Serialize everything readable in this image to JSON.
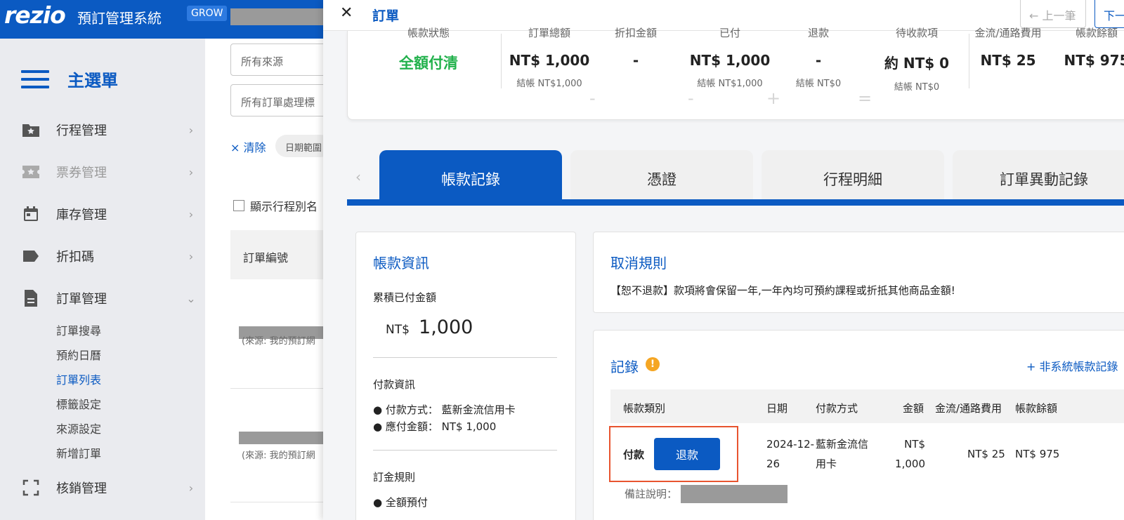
{
  "topbar": {
    "logo": "rezio",
    "system_title": "預訂管理系統",
    "plan_badge": "GROW"
  },
  "sidebar": {
    "title": "主選單",
    "items": [
      {
        "label": "行程管理",
        "icon": "folder-star-icon"
      },
      {
        "label": "票券管理",
        "icon": "ticket-star-icon"
      },
      {
        "label": "庫存管理",
        "icon": "calendar-icon"
      },
      {
        "label": "折扣碼",
        "icon": "tag-icon"
      },
      {
        "label": "訂單管理",
        "icon": "document-icon"
      },
      {
        "label": "核銷管理",
        "icon": "scan-icon"
      }
    ],
    "sub_items": [
      "訂單搜尋",
      "預約日曆",
      "訂單列表",
      "標籤設定",
      "來源設定",
      "新增訂單"
    ],
    "active_sub_item": "訂單列表"
  },
  "background_list": {
    "source_filter_placeholder": "所有來源",
    "tag_filter_placeholder": "所有訂單處理標",
    "clear_label": "× 清除",
    "date_chip": "日期範圍",
    "show_tour_name_label": "顯示行程別名",
    "column_header": "訂單編號",
    "rows": [
      {
        "source_text": "(來源: 我的預訂網"
      },
      {
        "source_text": "(來源: 我的預訂網"
      }
    ]
  },
  "panel": {
    "title": "訂單",
    "prev_label": "← 上一筆",
    "next_label": "下一"
  },
  "summary": {
    "status_label": "帳款狀態",
    "status_value": "全額付清",
    "total_label": "訂單總額",
    "total_value": "NT$ 1,000",
    "total_sub": "結帳 NT$1,000",
    "discount_label": "折扣金額",
    "discount_value": "-",
    "paid_label": "已付",
    "paid_value": "NT$ 1,000",
    "paid_sub": "結帳 NT$1,000",
    "refund_label": "退款",
    "refund_value": "-",
    "refund_sub": "結帳 NT$0",
    "receivable_label": "待收款項",
    "receivable_value": "約 NT$ 0",
    "receivable_sub": "結帳 NT$0",
    "fee_label": "金流/通路費用",
    "fee_value": "NT$ 25",
    "balance_label": "帳款餘額",
    "balance_value": "NT$ 975",
    "op_minus": "-",
    "op_plus": "+",
    "op_equal": "="
  },
  "tabs": [
    {
      "label": "帳款記錄",
      "active": true
    },
    {
      "label": "憑證",
      "active": false
    },
    {
      "label": "行程明細",
      "active": false
    },
    {
      "label": "訂單異動記錄",
      "active": false
    }
  ],
  "account_info": {
    "title": "帳款資訊",
    "paid_total_label": "累積已付金額",
    "currency": "NT$",
    "amount": "1,000",
    "payment_info_label": "付款資訊",
    "payment_method": "● 付款方式： 藍新金流信用卡",
    "amount_due": "● 應付金額： NT$ 1,000",
    "deposit_rule_label": "訂金規則",
    "deposit_rule": "● 全額預付"
  },
  "cancel_rules": {
    "title": "取消規則",
    "text": "【恕不退款】款項將會保留一年,一年內均可預約課程或折抵其他商品金額!"
  },
  "records": {
    "title": "記錄",
    "add_link": "+ 非系統帳款記錄",
    "headers": [
      "帳款類別",
      "日期",
      "付款方式",
      "金額",
      "金流/通路費用",
      "帳款餘額"
    ],
    "row": {
      "type": "付款",
      "refund_button": "退款",
      "date_line1": "2024-12-",
      "date_line2": "26",
      "method_line1": "藍新金流信",
      "method_line2": "用卡",
      "amount_line1": "NT$",
      "amount_line2": "1,000",
      "fee": "NT$ 25",
      "balance": "NT$ 975",
      "note_label": "備註說明："
    },
    "accent_color": "#e8542f"
  },
  "colors": {
    "brand": "#0b5ac2",
    "success": "#22b14c",
    "warning": "#f5a623"
  }
}
